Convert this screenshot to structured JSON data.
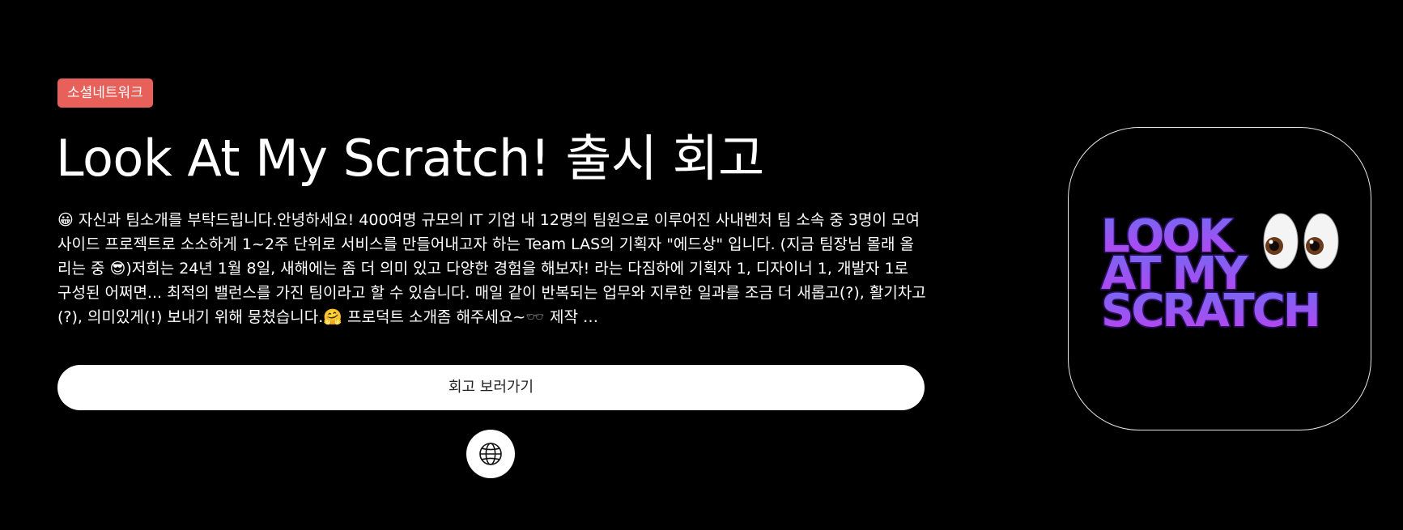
{
  "category_badge": "소셜네트워크",
  "title": "Look At My Scratch! 출시 회고",
  "description": "😀 자신과 팀소개를 부탁드립니다.안녕하세요! 400여명 규모의 IT 기업 내 12명의 팀원으로 이루어진 사내벤처 팀 소속 중 3명이 모여 사이드 프로젝트로 소소하게 1~2주 단위로 서비스를 만들어내고자 하는 Team LAS의 기획자 \"에드상\" 입니다. (지금 팀장님 몰래 올리는 중 😎)저희는 24년 1월 8일, 새해에는 좀 더 의미 있고 다양한 경험을 해보자! 라는 다짐하에 기획자 1, 디자이너 1, 개발자 1로 구성된 어쩌면... 최적의 밸런스를 가진 팀이라고 할 수 있습니다. 매일 같이 반복되는 업무와 지루한 일과를 조금 더 새롭고(?), 활기차고(?), 의미있게(!) 보내기 위해 뭉쳤습니다.🤗 프로덕트 소개좀 해주세요~🕶️ 제작 …",
  "cta_label": "회고 보러가기",
  "globe_icon": "globe-icon",
  "app_icon": {
    "logo_lines": [
      "LOOK",
      "AT MY",
      "SCRATCH"
    ],
    "emoji": "👀"
  },
  "colors": {
    "background": "#000000",
    "badge": "#e8605a",
    "logo_top": "#6f6cf2",
    "logo_bottom": "#c03ff0",
    "logo_outline": "#2a0f5e"
  }
}
